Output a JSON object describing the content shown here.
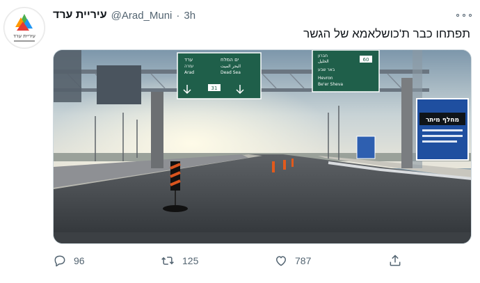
{
  "tweet": {
    "author_name": "עיריית ערד",
    "handle": "@Arad_Muni",
    "separator": "·",
    "time": "3h",
    "text": "תפתחו כבר ת'כושלאמא של הגשר",
    "avatar_logo_text": "עיריית ערד",
    "media": {
      "sign_left": {
        "lines": [
          "ערד",
          "עזרה",
          "Arad",
          "ים המלח",
          "البحر الميت",
          "Dead Sea"
        ],
        "route": "31"
      },
      "sign_right": {
        "lines": [
          "חברון",
          "الخليل",
          "באר שבע",
          "Hevron",
          "Be'er Sheva"
        ],
        "route": "60"
      },
      "sign_far_right": {
        "lines": [
          "מחלף מיתר"
        ]
      }
    },
    "actions": {
      "reply_count": "96",
      "retweet_count": "125",
      "like_count": "787"
    }
  },
  "colors": {
    "text_secondary": "#536471",
    "sign_green": "#1f5f4a",
    "sign_blue": "#1f4fa0"
  },
  "icons": [
    "more-icon",
    "reply-icon",
    "retweet-icon",
    "like-icon",
    "share-icon"
  ]
}
